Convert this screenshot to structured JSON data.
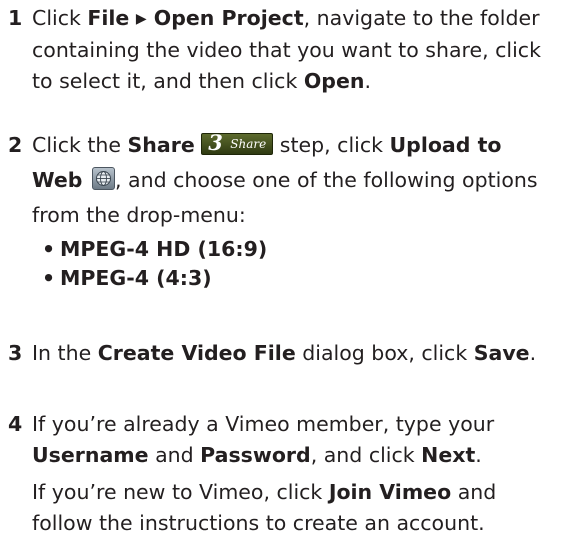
{
  "steps": [
    {
      "number": "1",
      "p1": {
        "t1": "Click ",
        "b1": "File",
        "tri": "▶",
        "b2": " Open Project",
        "t2": ", navigate to the folder containing the video that you want to share, click to select it, and then click ",
        "b3": "Open",
        "t3": "."
      }
    },
    {
      "number": "2",
      "p1": {
        "t1": "Click the ",
        "b1": "Share",
        "badge_digit": "3",
        "badge_text": "Share",
        "t2": " step, click ",
        "b2": "Upload to Web",
        "t3": ", and choose one of the following options from the drop-menu:"
      },
      "options": [
        "MPEG-4 HD (16:9)",
        "MPEG-4 (4:3)"
      ]
    },
    {
      "number": "3",
      "p1": {
        "t1": "In the ",
        "b1": "Create Video File",
        "t2": " dialog box, click ",
        "b2": "Save",
        "t3": "."
      }
    },
    {
      "number": "4",
      "p1": {
        "t1": "If you’re already a Vimeo member, type your ",
        "b1": "Username",
        "t2": " and ",
        "b2": "Password",
        "t3": ", and click ",
        "b3": "Next",
        "t4": "."
      },
      "p2": {
        "t1": "If you’re new to Vimeo, click ",
        "b1": "Join Vimeo",
        "t2": " and follow the instructions to create an account."
      }
    }
  ],
  "icons": {
    "share_step": "share-step-icon",
    "upload_to_web": "globe-icon"
  }
}
